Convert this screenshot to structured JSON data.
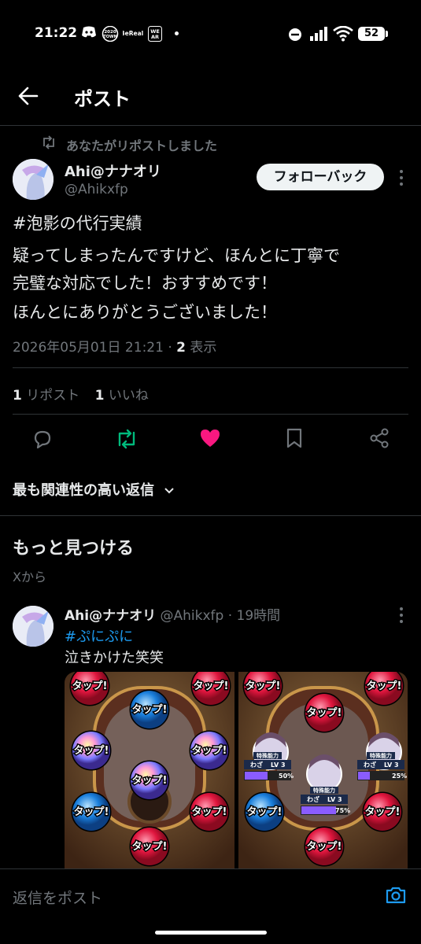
{
  "status_bar": {
    "time": "21:22",
    "app_icons": [
      "discord-icon",
      "2020town-icon",
      "bereal-icon",
      "wear-icon",
      "dot-icon"
    ],
    "battery": "52"
  },
  "header": {
    "title": "ポスト"
  },
  "repost_notice": "あなたがリポストしました",
  "post": {
    "display_name": "Ahi@ナナオリ",
    "handle": "@Ahikxfp",
    "follow_label": "フォローバック",
    "hashtag": "#泡影の代行実績",
    "body_lines": [
      "疑ってしまったんですけど、ほんとに丁寧で",
      "完璧な対応でした！おすすめです！",
      "ほんとにありがとうございました！"
    ],
    "timestamp": "2026年05月01日 21:21",
    "views_count": "2",
    "views_label": "表示"
  },
  "stats": {
    "reposts_count": "1",
    "reposts_label": "リポスト",
    "likes_count": "1",
    "likes_label": "いいね"
  },
  "actions": [
    "reply-icon",
    "repost-icon",
    "like-icon",
    "bookmark-icon",
    "share-icon"
  ],
  "colors": {
    "repost": "#00ba7c",
    "like": "#f91880",
    "link": "#1d9bf0"
  },
  "reply_sort": "最も関連性の高い返信",
  "discover": {
    "title": "もっと見つける",
    "source": "Xから",
    "post": {
      "display_name": "Ahi@ナナオリ",
      "handle": "@Ahikxfp",
      "time": "19時間",
      "hashtag": "#ぷにぷに",
      "text": "泣きかけた笑笑",
      "image_labels": {
        "tap": "タップ!",
        "skill": "特殊能力",
        "waza": "わざ",
        "lv": "LV 3",
        "pct1": "50%",
        "pct2": "25%",
        "pct3": "75%"
      }
    }
  },
  "reply_bar": {
    "placeholder": "返信をポスト"
  }
}
